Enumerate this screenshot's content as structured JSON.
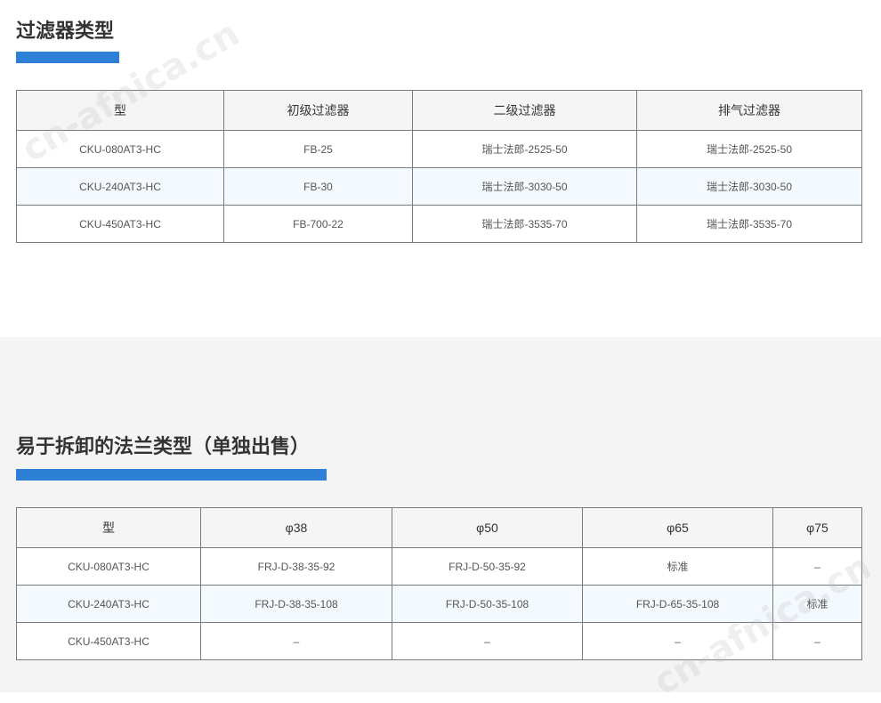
{
  "section1": {
    "title": "过滤器类型",
    "headers": [
      "型",
      "初级过滤器",
      "二级过滤器",
      "排气过滤器"
    ],
    "rows": [
      [
        "CKU-080AT3-HC",
        "FB-25",
        "瑞士法郎-2525-50",
        "瑞士法郎-2525-50"
      ],
      [
        "CKU-240AT3-HC",
        "FB-30",
        "瑞士法郎-3030-50",
        "瑞士法郎-3030-50"
      ],
      [
        "CKU-450AT3-HC",
        "FB-700-22",
        "瑞士法郎-3535-70",
        "瑞士法郎-3535-70"
      ]
    ]
  },
  "section2": {
    "title": "易于拆卸的法兰类型（单独出售）",
    "headers": [
      "型",
      "φ38",
      "φ50",
      "φ65",
      "φ75"
    ],
    "rows": [
      [
        "CKU-080AT3-HC",
        "FRJ-D-38-35-92",
        "FRJ-D-50-35-92",
        "标准",
        "–"
      ],
      [
        "CKU-240AT3-HC",
        "FRJ-D-38-35-108",
        "FRJ-D-50-35-108",
        "FRJ-D-65-35-108",
        "标准"
      ],
      [
        "CKU-450AT3-HC",
        "–",
        "–",
        "–",
        "–"
      ]
    ]
  },
  "watermark": "cn-afnica.cn",
  "colors": {
    "accent": "#2e7fd6",
    "header_bg": "#f5f5f5",
    "alt_row_bg": "#f4f9fe",
    "section2_bg": "#f4f4f4",
    "border": "#7a7a7a"
  }
}
